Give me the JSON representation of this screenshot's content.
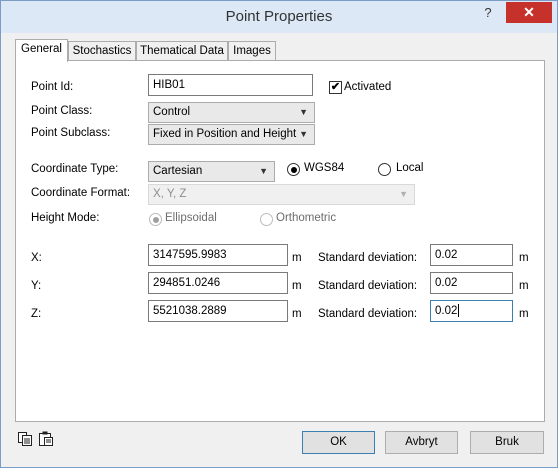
{
  "window": {
    "title": "Point Properties",
    "help_label": "?",
    "close_label": "✕"
  },
  "tabs": [
    {
      "label": "General",
      "active": true
    },
    {
      "label": "Stochastics",
      "active": false
    },
    {
      "label": "Thematical Data",
      "active": false
    },
    {
      "label": "Images",
      "active": false
    }
  ],
  "form": {
    "point_id_label": "Point Id:",
    "point_id_value": "HIB01",
    "activated_label": "Activated",
    "activated_checked": true,
    "activated_mark": "✔",
    "point_class_label": "Point Class:",
    "point_class_value": "Control",
    "point_subclass_label": "Point Subclass:",
    "point_subclass_value": "Fixed in Position and Height",
    "coord_type_label": "Coordinate Type:",
    "coord_type_value": "Cartesian",
    "wgs84_label": "WGS84",
    "wgs84_checked": true,
    "local_label": "Local",
    "local_checked": false,
    "coord_format_label": "Coordinate Format:",
    "coord_format_value": "X, Y, Z",
    "height_mode_label": "Height Mode:",
    "ellipsoidal_label": "Ellipsoidal",
    "orthometric_label": "Orthometric"
  },
  "coordinates": [
    {
      "label": "X:",
      "value": "3147595.9983",
      "unit": "m",
      "std_label": "Standard deviation:",
      "std_value": "0.02",
      "std_unit": "m"
    },
    {
      "label": "Y:",
      "value": "294851.0246",
      "unit": "m",
      "std_label": "Standard deviation:",
      "std_value": "0.02",
      "std_unit": "m"
    },
    {
      "label": "Z:",
      "value": "5521038.2889",
      "unit": "m",
      "std_label": "Standard deviation:",
      "std_value": "0.02",
      "std_unit": "m"
    }
  ],
  "buttons": {
    "ok": "OK",
    "cancel": "Avbryt",
    "apply": "Bruk"
  },
  "icons": {
    "footer_left_1": "copy-icon",
    "footer_left_2": "paste-icon",
    "dropdown": "chevron-down-icon"
  },
  "colors": {
    "titlebar": "#dce8f6",
    "close": "#c7312c",
    "focus": "#3c7fb1"
  }
}
